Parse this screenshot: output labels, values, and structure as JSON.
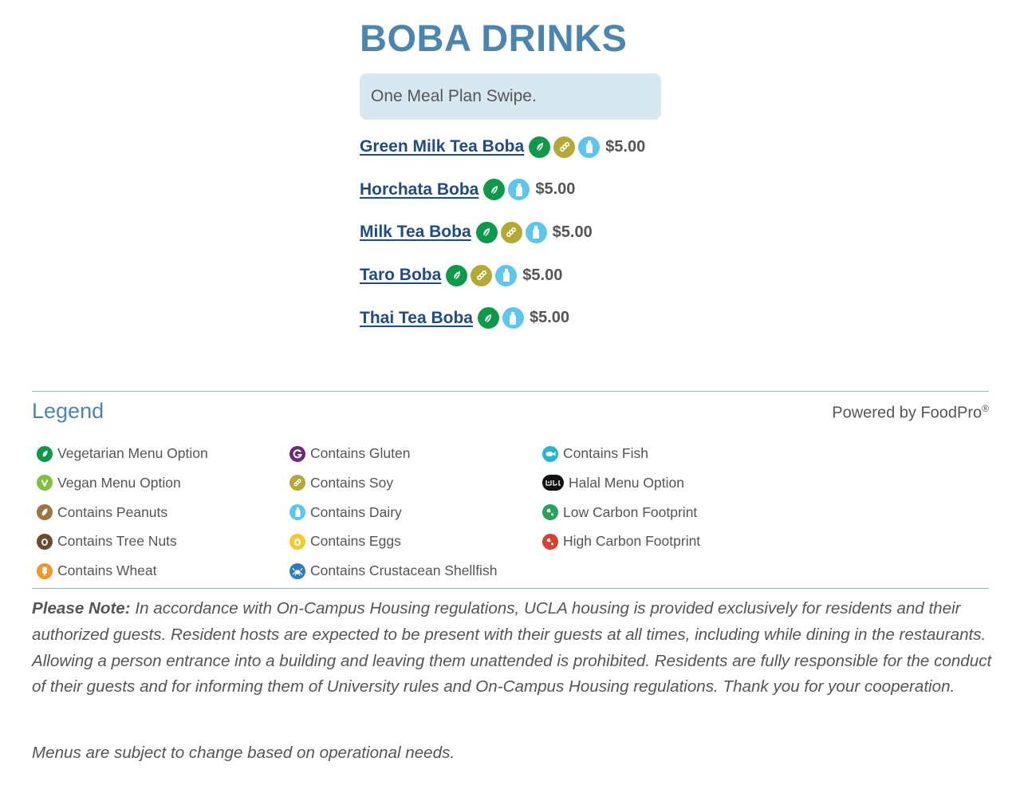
{
  "menu": {
    "title": "BOBA DRINKS",
    "meal_plan_note": "One Meal Plan Swipe.",
    "items": [
      {
        "name": "Green Milk Tea Boba",
        "icons": [
          "vegetarian-icon",
          "soy-icon",
          "dairy-icon"
        ],
        "price": "$5.00"
      },
      {
        "name": "Horchata Boba",
        "icons": [
          "vegetarian-icon",
          "dairy-icon"
        ],
        "price": "$5.00"
      },
      {
        "name": "Milk Tea Boba",
        "icons": [
          "vegetarian-icon",
          "soy-icon",
          "dairy-icon"
        ],
        "price": "$5.00"
      },
      {
        "name": "Taro Boba",
        "icons": [
          "vegetarian-icon",
          "soy-icon",
          "dairy-icon"
        ],
        "price": "$5.00"
      },
      {
        "name": "Thai Tea Boba",
        "icons": [
          "vegetarian-icon",
          "dairy-icon"
        ],
        "price": "$5.00"
      }
    ]
  },
  "legend": {
    "title": "Legend",
    "powered_by": "Powered by FoodPro",
    "powered_mark": "®",
    "columns": [
      [
        {
          "label": "Vegetarian Menu Option",
          "icon": "vegetarian-icon"
        },
        {
          "label": "Vegan Menu Option",
          "icon": "vegan-icon"
        },
        {
          "label": "Contains Peanuts",
          "icon": "peanut-icon"
        },
        {
          "label": "Contains Tree Nuts",
          "icon": "tree-nut-icon"
        },
        {
          "label": "Contains Wheat",
          "icon": "wheat-icon"
        }
      ],
      [
        {
          "label": "Contains Gluten",
          "icon": "gluten-icon"
        },
        {
          "label": "Contains Soy",
          "icon": "soy-icon"
        },
        {
          "label": "Contains Dairy",
          "icon": "dairy-icon"
        },
        {
          "label": "Contains Eggs",
          "icon": "egg-icon"
        },
        {
          "label": "Contains Crustacean Shellfish",
          "icon": "shellfish-icon"
        }
      ],
      [
        {
          "label": "Contains Fish",
          "icon": "fish-icon"
        },
        {
          "label": "Halal Menu Option",
          "icon": "halal-icon"
        },
        {
          "label": "Low Carbon Footprint",
          "icon": "low-carbon-icon"
        },
        {
          "label": "High Carbon Footprint",
          "icon": "high-carbon-icon"
        }
      ]
    ]
  },
  "notice": {
    "bold_lead": "Please Note:",
    "text": " In accordance with On-Campus Housing regulations, UCLA housing is provided exclusively for residents and their authorized guests. Resident hosts are expected to be present with their guests at all times, including while dining in the restaurants. Allowing a person entrance into a building and leaving them unattended is prohibited. Residents are fully responsible for the conduct of their guests and for informing them of University rules and On-Campus Housing regulations. Thank you for your cooperation.",
    "menus_change": "Menus are subject to change based on operational needs."
  },
  "colors": {
    "title_blue": "#4a86ad",
    "link_blue": "#1f4b87",
    "meal_box_bg": "#d7e8f1",
    "vegetarian": "#0c9a4a",
    "vegan": "#7fbf3f",
    "peanut": "#a07344",
    "tree_nut": "#6b4a2e",
    "wheat": "#f0962a",
    "gluten": "#6d2a7b",
    "soy": "#b5a935",
    "dairy": "#5bc6ee",
    "egg": "#f7c928",
    "shellfish": "#2b7bbf",
    "fish": "#25b7cf",
    "halal": "#111111",
    "low_carbon": "#2ba05a",
    "high_carbon": "#d6402e"
  }
}
